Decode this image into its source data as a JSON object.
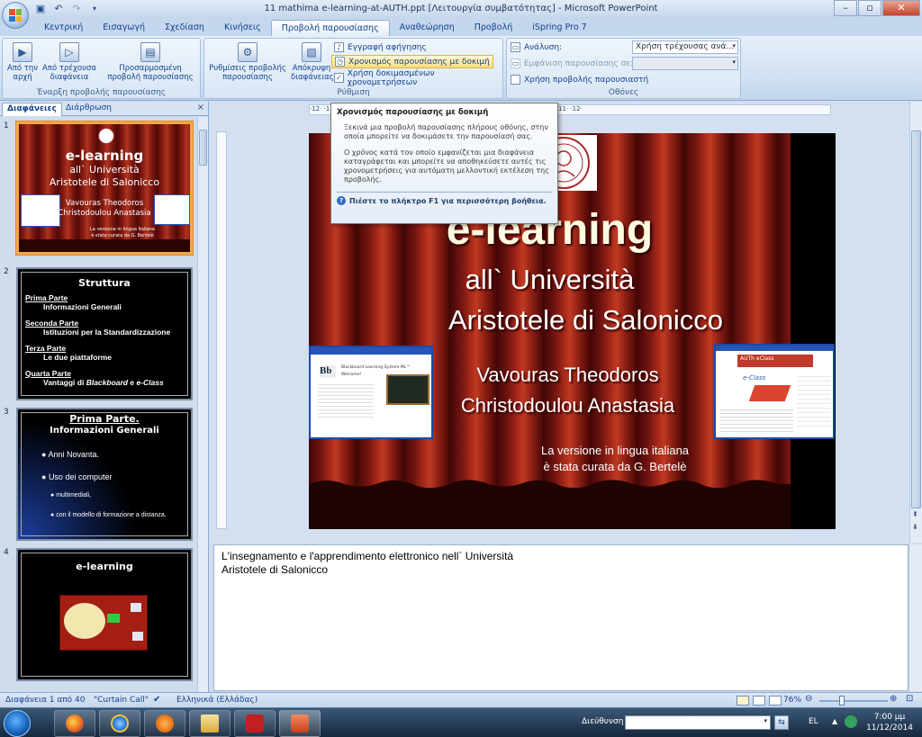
{
  "window": {
    "title": "11 mathima e-learning-at-AUTH.ppt [Λειτουργία συμβατότητας] - Microsoft PowerPoint"
  },
  "tabs": [
    "Κεντρική",
    "Εισαγωγή",
    "Σχεδίαση",
    "Κινήσεις",
    "Προβολή παρουσίασης",
    "Αναθεώρηση",
    "Προβολή",
    "iSpring Pro 7"
  ],
  "ribbon": {
    "group1": {
      "label": "Έναρξη προβολής παρουσίασης",
      "btn_from_start": "Από την\nαρχή",
      "btn_from_current": "Από τρέχουσα\nδιαφάνεια",
      "btn_custom": "Προσαρμοσμένη\nπροβολή παρουσίασης"
    },
    "group2": {
      "label": "Ρύθμιση",
      "btn_setup": "Ρυθμίσεις προβολής\nπαρουσίασης",
      "btn_hide": "Απόκρυψη\nδιαφάνειας",
      "record_narration": "Εγγραφή αφήγησης",
      "rehearse_timings": "Χρονισμός παρουσίασης με δοκιμή",
      "use_timings": "Χρήση δοκιμασμένων χρονομετρήσεων"
    },
    "group3": {
      "label": "Οθόνες",
      "resolution_label": "Ανάλυση:",
      "resolution_value": "Χρήση τρέχουσας ανά...",
      "show_on_label": "Εμφάνιση παρουσίασης σε:",
      "presenter_view": "Χρήση προβολής παρουσιαστή"
    }
  },
  "tooltip": {
    "title": "Χρονισμός παρουσίασης με δοκιμή",
    "para1": "Ξεκινά μια προβολή παρουσίασης πλήρους οθόνης, στην οποία μπορείτε να δοκιμάσετε την παρουσίασή σας.",
    "para2": "Ο χρόνος κατά τον οποίο εμφανίζεται μια διαφάνεια καταγράφεται και μπορείτε να αποθηκεύσετε αυτές τις χρονομετρήσεις για αυτόματη μελλοντική εκτέλεση της προβολής.",
    "help": "Πιέστε το πλήκτρο F1 για περισσότερη βοήθεια."
  },
  "panel": {
    "tab_slides": "Διαφάνειες",
    "tab_outline": "Διάρθρωση",
    "close": "×"
  },
  "thumbs": {
    "t1": {
      "num": "1",
      "title": "e-learning",
      "l1": "all` Università",
      "l2": "Aristotele di Salonicco",
      "l3": "Vavouras Theodoros",
      "l4": "Christodoulou Anastasia",
      "l5": "La versione in lingua italiana",
      "l6": "è stata curata da G. Bertelè"
    },
    "t2": {
      "num": "2",
      "title": "Struttura",
      "h1": "Prima Parte",
      "s1": "Informazioni Generali",
      "h2": "Seconda Parte",
      "s2": "Istituzioni per la Standardizzazione",
      "h3": "Terza Parte",
      "s3": "Le due piattaforme",
      "h4": "Quarta Parte",
      "s4a": "Vantaggi di ",
      "s4b": "Blackboard",
      "s4c": " e ",
      "s4d": "e-Class"
    },
    "t3": {
      "num": "3",
      "title": "Prima Parte.",
      "subtitle": "Informazioni Generali",
      "b1": "Anni Novanta.",
      "b2": "Uso dei computer",
      "b3": "multimediali,",
      "b4": "con il modello di formazione a distanza."
    },
    "t4": {
      "num": "4",
      "title": "e-learning"
    }
  },
  "ruler": {
    "h": "·12·  ·11·  ·10·  ·9·  ·8·  ·7·  ·6·  ·5·  ·4·  ·3·  ·2·  ·1·  ·0·  ·1·  ·2·  ·3·  ·4·  ·5·  ·6·  ·7·  ·8·  ·9·  ·10·  ·11·  ·12·"
  },
  "slide": {
    "title": "e-learning",
    "line1": "all` Università",
    "line2": "Aristotele di Salonicco",
    "author1": "Vavouras Theodoros",
    "author2": "Christodoulou Anastasia",
    "credit1": "La versione in lingua italiana",
    "credit2": "è stata curata da G. Bertelè",
    "shot_left_title": "Blackboard Learning System ML™",
    "shot_left_welcome": "Welcome!",
    "shot_right_title": "AUTh eClass",
    "shot_right_logo": "e-Class"
  },
  "notes": {
    "text1": "L'insegnamento e l'apprendimento elettronico nell` Università",
    "text2": "Aristotele di Salonicco"
  },
  "status": {
    "slide_count": "Διαφάνεια 1 από 40",
    "theme": "\"Curtain Call\"",
    "language": "Ελληνικά (Ελλάδας)",
    "zoom": "76%"
  },
  "taskbar": {
    "address_label": "Διεύθυνση",
    "lang": "EL",
    "time": "7:00 μμ",
    "date": "11/12/2014"
  }
}
